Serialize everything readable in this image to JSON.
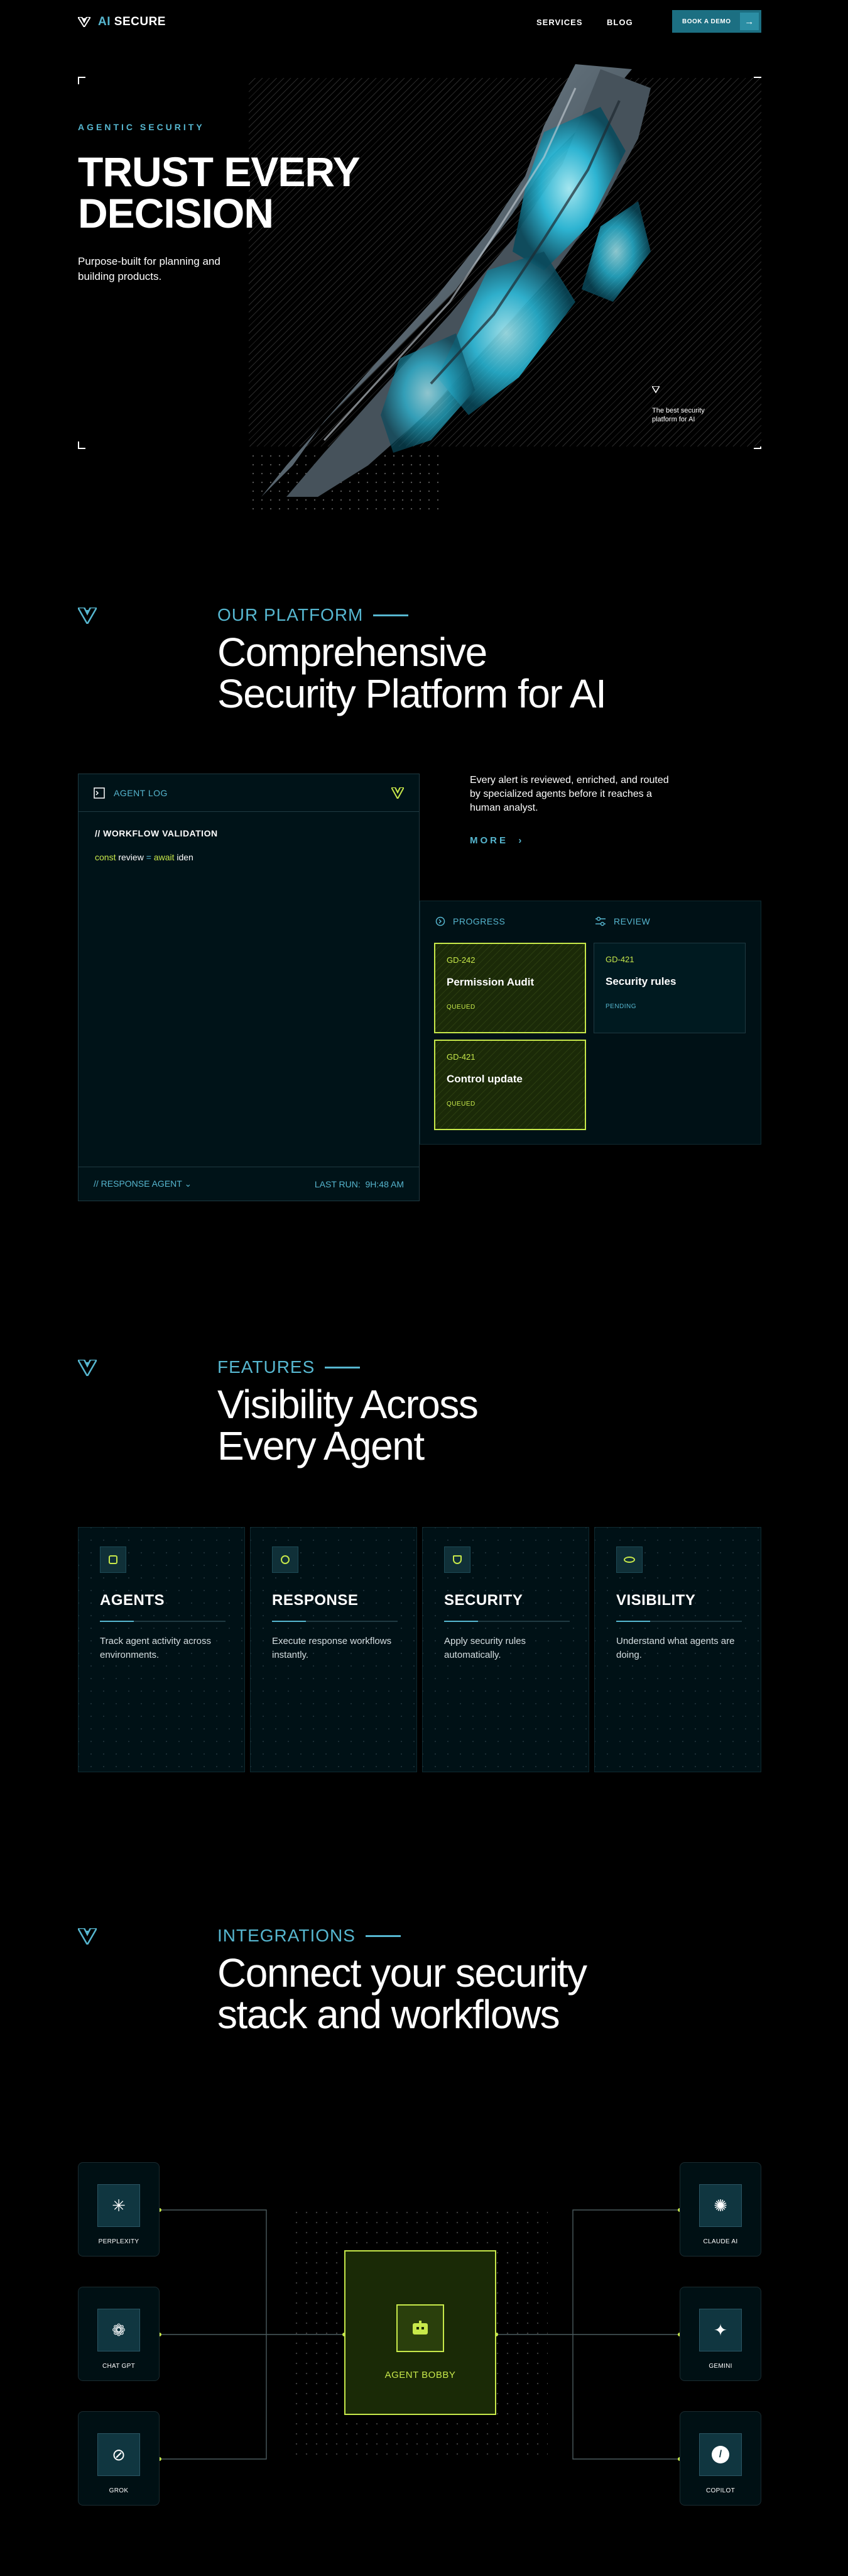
{
  "nav": {
    "logo_prefix": "AI",
    "logo_text": "SECURE",
    "links": [
      "SERVICES",
      "BLOG"
    ],
    "cta_label": "BOOK A DEMO"
  },
  "hero": {
    "eyebrow": "AGENTIC SECURITY",
    "title_line1": "TRUST EVERY",
    "title_line2": "DECISION",
    "subtitle": "Purpose-built for planning and building products.",
    "caption": "The best security platform for AI"
  },
  "platform": {
    "label": "OUR PLATFORM",
    "title_line1": "Comprehensive",
    "title_line2": "Security Platform for AI",
    "description": "Every alert is reviewed, enriched, and routed by specialized agents before it reaches a human analyst.",
    "more_label": "MORE",
    "agent_log": {
      "title": "AGENT LOG",
      "line1": "// WORKFLOW VALIDATION",
      "code_const": "const",
      "code_review": "review",
      "code_eq": "=",
      "code_await": "await",
      "code_iden": "iden",
      "footer_left": "// RESPONSE AGENT",
      "footer_right_label": "LAST RUN:",
      "footer_right_time": "9H:48 AM"
    },
    "board": {
      "col_progress": "PROGRESS",
      "col_review": "REVIEW",
      "cards": [
        {
          "id": "GD-242",
          "title": "Permission Audit",
          "status": "QUEUED"
        },
        {
          "id": "GD-421",
          "title": "Security rules",
          "status": "PENDING"
        },
        {
          "id": "GD-421",
          "title": "Control update",
          "status": "QUEUED"
        }
      ]
    }
  },
  "features": {
    "label": "FEATURES",
    "title_line1": "Visibility Across",
    "title_line2": "Every Agent",
    "items": [
      {
        "title": "AGENTS",
        "desc": "Track agent activity across environments."
      },
      {
        "title": "RESPONSE",
        "desc": "Execute response workflows instantly."
      },
      {
        "title": "SECURITY",
        "desc": "Apply security rules automatically."
      },
      {
        "title": "VISIBILITY",
        "desc": "Understand what agents are doing."
      }
    ]
  },
  "integrations": {
    "label": "INTEGRATIONS",
    "title_line1": "Connect your security",
    "title_line2": "stack and workflows",
    "center": "AGENT BOBBY",
    "left_nodes": [
      "PERPLEXITY",
      "CHAT GPT",
      "GROK"
    ],
    "right_nodes": [
      "CLAUDE AI",
      "GEMINI",
      "COPILOT"
    ]
  },
  "colors": {
    "accent_cyan": "#56b6cf",
    "accent_lime": "#c7e84a",
    "background": "#000000"
  }
}
